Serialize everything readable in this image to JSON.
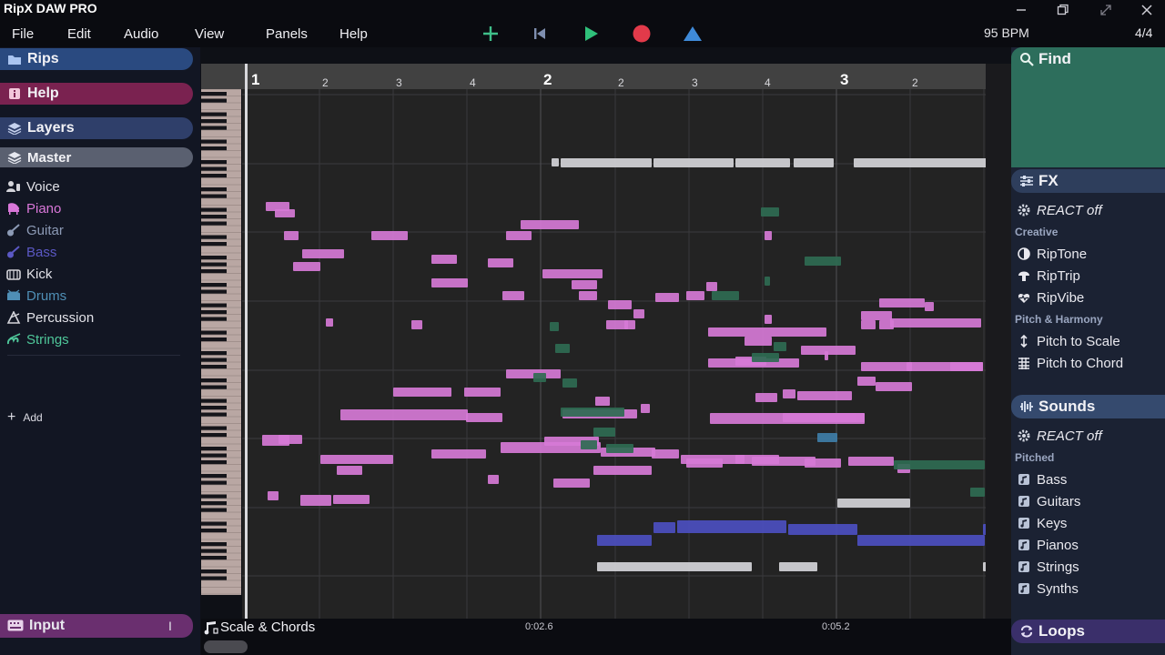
{
  "app": {
    "title": "RipX DAW PRO"
  },
  "menu": {
    "items": [
      "File",
      "Edit",
      "Audio",
      "View",
      "Panels",
      "Help"
    ]
  },
  "toolbar": {
    "tempo": "95 BPM",
    "time_signature": "4/4"
  },
  "left_panel": {
    "headers": {
      "rips": "Rips",
      "help": "Help",
      "layers": "Layers",
      "master": "Master",
      "input": "Input"
    },
    "layers": [
      {
        "label": "Voice",
        "color": "#e2e2e8",
        "icon": "voice-icon"
      },
      {
        "label": "Piano",
        "color": "#d977d9",
        "icon": "piano-icon"
      },
      {
        "label": "Guitar",
        "color": "#8d9bb6",
        "icon": "guitar-icon"
      },
      {
        "label": "Bass",
        "color": "#5b58c4",
        "icon": "bass-icon"
      },
      {
        "label": "Kick",
        "color": "#e2e2e8",
        "icon": "kick-icon"
      },
      {
        "label": "Drums",
        "color": "#4f8fb6",
        "icon": "drums-icon"
      },
      {
        "label": "Percussion",
        "color": "#e2e2e8",
        "icon": "percussion-icon"
      },
      {
        "label": "Strings",
        "color": "#4fc79a",
        "icon": "strings-icon"
      }
    ],
    "add_label": "Add"
  },
  "timeline": {
    "bars": [
      {
        "label": "1"
      },
      {
        "label": "2"
      },
      {
        "label": "3"
      }
    ],
    "beats": [
      "2",
      "3",
      "4",
      "2",
      "3",
      "4",
      "2"
    ]
  },
  "bottom": {
    "scale_chords": "Scale & Chords",
    "time_labels": [
      "0:02.6",
      "0:05.2"
    ]
  },
  "right_panel": {
    "find": "Find",
    "fx": {
      "title": "FX",
      "react": "REACT off",
      "categories": [
        {
          "name": "Creative",
          "items": [
            {
              "label": "RipTone",
              "icon": "half-circle-icon"
            },
            {
              "label": "RipTrip",
              "icon": "mushroom-icon"
            },
            {
              "label": "RipVibe",
              "icon": "heart-pulse-icon"
            }
          ]
        },
        {
          "name": "Pitch & Harmony",
          "items": [
            {
              "label": "Pitch to Scale",
              "icon": "pitch-scale-icon"
            },
            {
              "label": "Pitch to Chord",
              "icon": "pitch-chord-icon"
            }
          ]
        }
      ]
    },
    "sounds": {
      "title": "Sounds",
      "react": "REACT off",
      "category": "Pitched",
      "items": [
        "Bass",
        "Guitars",
        "Keys",
        "Pianos",
        "Strings",
        "Synths"
      ]
    },
    "loops": "Loops"
  },
  "colors": {
    "piano_notes": "#d67ad6",
    "bass_notes": "#4c4fc0",
    "strings_notes": "#2f6b52",
    "voice_notes": "#d4d4d8",
    "guitar_notes": "#3f7ea8",
    "rips_header": "#2a4a80",
    "help_header": "#7a2250",
    "layers_header": "#2f3f6a",
    "master_header": "#5a6070",
    "fx_header": "#2e3e5c",
    "sounds_header": "#354a6e",
    "loops_header": "#3a2f6a",
    "find_header": "#2d6e5c"
  }
}
